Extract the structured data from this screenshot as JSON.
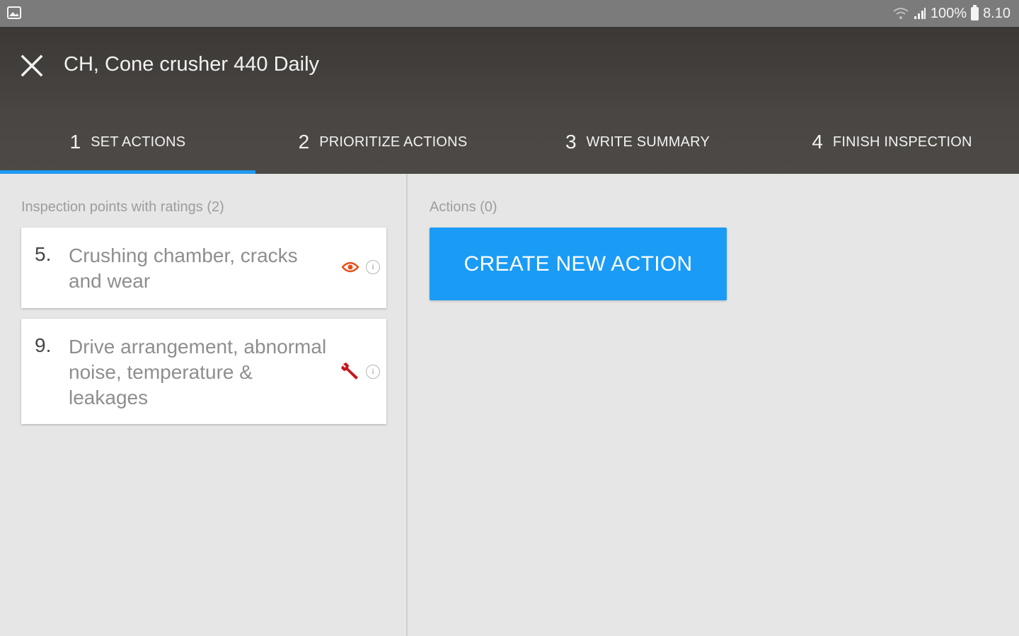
{
  "status_bar": {
    "battery": "100%",
    "time": "8.10",
    "icons": [
      "image-icon",
      "wifi-icon",
      "signal-icon",
      "battery-icon"
    ]
  },
  "header": {
    "title": "CH, Cone crusher 440 Daily",
    "close_icon": "close-icon"
  },
  "tabs": [
    {
      "number": "1",
      "label": "SET ACTIONS",
      "active": true
    },
    {
      "number": "2",
      "label": "PRIORITIZE ACTIONS",
      "active": false
    },
    {
      "number": "3",
      "label": "WRITE SUMMARY",
      "active": false
    },
    {
      "number": "4",
      "label": "FINISH INSPECTION",
      "active": false
    }
  ],
  "left_panel": {
    "heading": "Inspection points with ratings (2)",
    "items": [
      {
        "number": "5.",
        "text": "Crushing chamber, cracks and wear",
        "status_icon": "eye-icon",
        "info_icon": "info-icon"
      },
      {
        "number": "9.",
        "text": "Drive arrangement, abnormal noise, temperature & leakages",
        "status_icon": "wrench-icon",
        "info_icon": "info-icon"
      }
    ]
  },
  "right_panel": {
    "heading": "Actions (0)",
    "create_button_label": "CREATE NEW ACTION"
  },
  "colors": {
    "accent": "#1a9bf5",
    "header_bg": "#45413e",
    "eye_icon": "#e8501a",
    "wrench_icon": "#c8141e"
  }
}
